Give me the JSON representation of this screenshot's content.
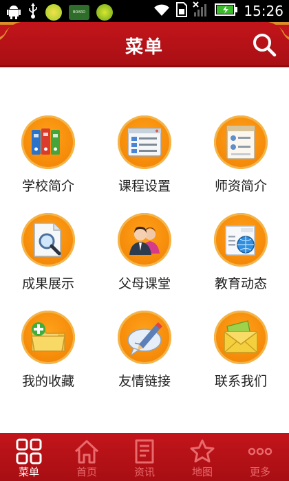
{
  "status_bar": {
    "time": "15:26",
    "left_icons": [
      "android-debug-icon",
      "usb-icon",
      "app-icon-1",
      "keyboard-test-app-icon",
      "app-icon-2"
    ],
    "keyboard_app_text": "BOARD TEST",
    "right_icons": [
      "wifi-icon",
      "sim-icon",
      "signal-icon",
      "battery-icon"
    ]
  },
  "header": {
    "title": "菜单",
    "search_icon": "search-icon",
    "accent_color": "#b5121b"
  },
  "menu_items": [
    {
      "label": "学校简介",
      "icon": "binders-icon"
    },
    {
      "label": "课程设置",
      "icon": "list-window-icon"
    },
    {
      "label": "师资简介",
      "icon": "profile-document-icon"
    },
    {
      "label": "成果展示",
      "icon": "magnifier-document-icon"
    },
    {
      "label": "父母课堂",
      "icon": "parents-icon"
    },
    {
      "label": "教育动态",
      "icon": "news-globe-icon"
    },
    {
      "label": "我的收藏",
      "icon": "folder-add-icon"
    },
    {
      "label": "友情链接",
      "icon": "pen-bubble-icon"
    },
    {
      "label": "联系我们",
      "icon": "envelope-icon"
    }
  ],
  "tab_bar": {
    "tabs": [
      {
        "label": "菜单",
        "icon": "grid-icon",
        "active": true
      },
      {
        "label": "首页",
        "icon": "home-icon",
        "active": false
      },
      {
        "label": "资讯",
        "icon": "news-icon",
        "active": false
      },
      {
        "label": "地图",
        "icon": "star-icon",
        "active": false
      },
      {
        "label": "更多",
        "icon": "more-icon",
        "active": false
      }
    ]
  }
}
